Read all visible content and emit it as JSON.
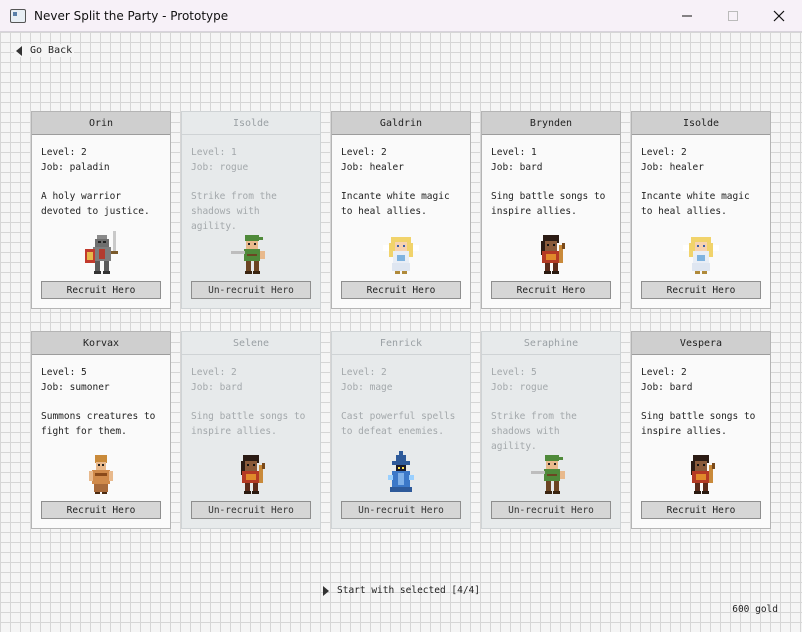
{
  "window": {
    "title": "Never Split the Party - Prototype"
  },
  "nav": {
    "back_label": "Go Back"
  },
  "heroes": [
    {
      "name": "Orin",
      "level_text": "Level: 2",
      "job_text": "Job: paladin",
      "desc": "A holy warrior devoted to justice.",
      "button": "Recruit Hero",
      "selected": false,
      "sprite": "paladin-sprite"
    },
    {
      "name": "Isolde",
      "level_text": "Level: 1",
      "job_text": "Job: rogue",
      "desc": "Strike from the shadows with agility.",
      "button": "Un-recruit Hero",
      "selected": true,
      "sprite": "rogue-sprite"
    },
    {
      "name": "Galdrin",
      "level_text": "Level: 2",
      "job_text": "Job: healer",
      "desc": "Incante white magic to heal allies.",
      "button": "Recruit Hero",
      "selected": false,
      "sprite": "healer-sprite"
    },
    {
      "name": "Brynden",
      "level_text": "Level: 1",
      "job_text": "Job: bard",
      "desc": "Sing battle songs to inspire allies.",
      "button": "Recruit Hero",
      "selected": false,
      "sprite": "bard-sprite"
    },
    {
      "name": "Isolde",
      "level_text": "Level: 2",
      "job_text": "Job: healer",
      "desc": "Incante white magic to heal allies.",
      "button": "Recruit Hero",
      "selected": false,
      "sprite": "healer-sprite"
    },
    {
      "name": "Korvax",
      "level_text": "Level: 5",
      "job_text": "Job: sumoner",
      "desc": "Summons creatures to fight for them.",
      "button": "Recruit Hero",
      "selected": false,
      "sprite": "summoner-sprite"
    },
    {
      "name": "Selene",
      "level_text": "Level: 2",
      "job_text": "Job: bard",
      "desc": "Sing battle songs to inspire allies.",
      "button": "Un-recruit Hero",
      "selected": true,
      "sprite": "bard-sprite"
    },
    {
      "name": "Fenrick",
      "level_text": "Level: 2",
      "job_text": "Job: mage",
      "desc": "Cast powerful spells to defeat enemies.",
      "button": "Un-recruit Hero",
      "selected": true,
      "sprite": "mage-sprite"
    },
    {
      "name": "Seraphine",
      "level_text": "Level: 5",
      "job_text": "Job: rogue",
      "desc": "Strike from the shadows with agility.",
      "button": "Un-recruit Hero",
      "selected": true,
      "sprite": "rogue-sprite"
    },
    {
      "name": "Vespera",
      "level_text": "Level: 2",
      "job_text": "Job: bard",
      "desc": "Sing battle songs to inspire allies.",
      "button": "Recruit Hero",
      "selected": false,
      "sprite": "bard-sprite"
    }
  ],
  "footer": {
    "start_label": "Start with selected [4/4]",
    "gold": "600 gold"
  }
}
